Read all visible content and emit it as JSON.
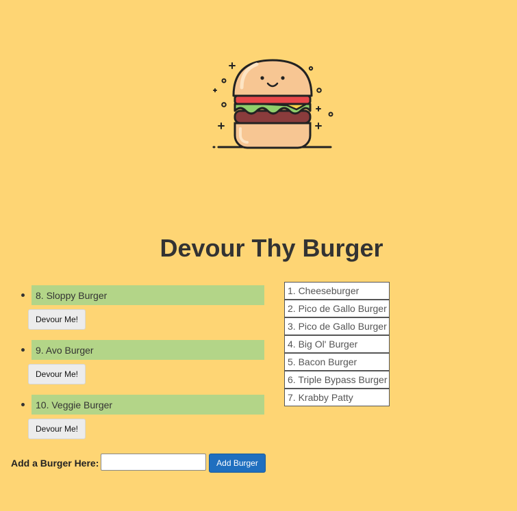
{
  "header": {
    "title": "Devour Thy Burger",
    "logo_icon": "burger-icon"
  },
  "uneaten_burgers": [
    {
      "label": "8. Sloppy Burger",
      "button_label": "Devour Me!"
    },
    {
      "label": "9. Avo Burger",
      "button_label": "Devour Me!"
    },
    {
      "label": "10. Veggie Burger",
      "button_label": "Devour Me!"
    }
  ],
  "devoured_burgers": [
    "1. Cheeseburger",
    "2. Pico de Gallo Burger",
    "3. Pico de Gallo Burger",
    "4. Big Ol' Burger",
    "5. Bacon Burger",
    "6. Triple Bypass Burger",
    "7. Krabby Patty"
  ],
  "add_form": {
    "label": "Add a Burger Here:",
    "input_value": "",
    "button_label": "Add Burger"
  },
  "colors": {
    "background": "#fed574",
    "uneaten_bg": "#b3d588",
    "add_button": "#1f6fbf"
  }
}
